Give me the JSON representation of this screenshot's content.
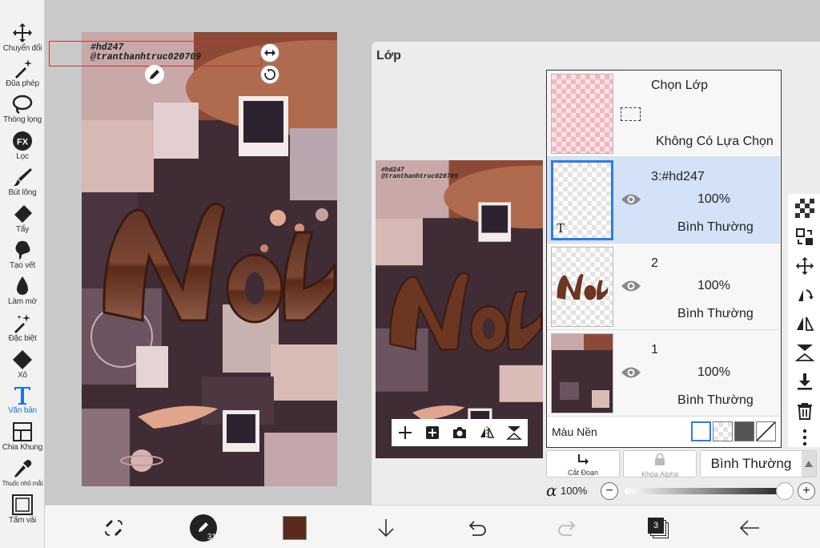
{
  "toolbar": {
    "tools": [
      {
        "id": "transform",
        "label": "Chuyển đổi",
        "icon": "move-icon"
      },
      {
        "id": "magic-wand",
        "label": "Đũa phép",
        "icon": "magic-wand-icon"
      },
      {
        "id": "lasso",
        "label": "Thòng lọng",
        "icon": "lasso-icon"
      },
      {
        "id": "filter",
        "label": "Lọc",
        "icon": "fx-icon"
      },
      {
        "id": "brush",
        "label": "Bút lông",
        "icon": "brush-icon"
      },
      {
        "id": "eraser",
        "label": "Tẩy",
        "icon": "eraser-icon"
      },
      {
        "id": "smudge",
        "label": "Tạo vết",
        "icon": "smudge-icon"
      },
      {
        "id": "blur",
        "label": "Làm mờ",
        "icon": "drop-icon"
      },
      {
        "id": "special",
        "label": "Đặc biệt",
        "icon": "sparkle-icon"
      },
      {
        "id": "fill",
        "label": "Xô",
        "icon": "bucket-icon"
      },
      {
        "id": "text",
        "label": "Văn bản",
        "icon": "text-icon",
        "active": true
      },
      {
        "id": "frame",
        "label": "Chia Khung",
        "icon": "frame-divider-icon"
      },
      {
        "id": "eyedropper",
        "label": "Thuốc nhỏ mắt",
        "icon": "eyedropper-icon"
      },
      {
        "id": "canvas",
        "label": "Tấm vải",
        "icon": "canvas-icon"
      }
    ]
  },
  "canvas": {
    "caption_line1": "#hd247",
    "caption_line2": "@tranthanhtruc020709",
    "art_word": "Not"
  },
  "layer_panel": {
    "title": "Lớp",
    "selection_layer": {
      "title": "Chọn Lớp",
      "status": "Không Có Lựa Chọn"
    },
    "layers": [
      {
        "name": "3:#hd247",
        "opacity": "100%",
        "blend": "Bình Thường",
        "selected": true,
        "type_marker": "T"
      },
      {
        "name": "2",
        "opacity": "100%",
        "blend": "Bình Thường",
        "selected": false
      },
      {
        "name": "1",
        "opacity": "100%",
        "blend": "Bình Thường",
        "selected": false
      }
    ],
    "background_label": "Màu Nền",
    "blend_controls": {
      "clip_label": "Cắt Đoạn",
      "alpha_lock_label": "Khóa Alpha",
      "blend_mode": "Bình Thường"
    },
    "alpha": {
      "symbol": "α",
      "value": "100%",
      "level": 1.0
    }
  },
  "bottom_bar": {
    "brush_size": "31",
    "layer_count": "3",
    "color": "#5a2a1e"
  },
  "colors": {
    "accent": "#1a73e8",
    "selected_layer_bg": "#d3e2f7",
    "art_bg": "#3f2c35",
    "art_brown": "#6b3622"
  }
}
